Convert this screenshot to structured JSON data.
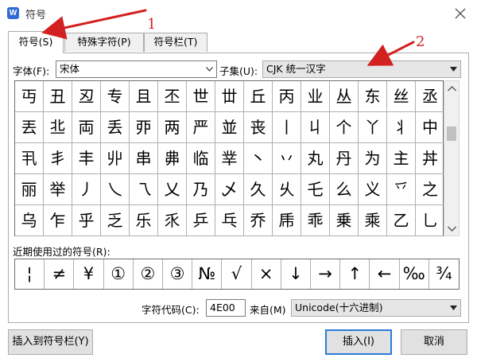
{
  "window": {
    "title": "符号",
    "app_icon": "W",
    "close_icon": "close-icon"
  },
  "tabs": [
    {
      "label": "符号(S)",
      "active": true
    },
    {
      "label": "特殊字符(P)",
      "active": false
    },
    {
      "label": "符号栏(T)",
      "active": false
    }
  ],
  "font": {
    "label": "字体(F):",
    "value": "宋体"
  },
  "subset": {
    "label": "子集(U):",
    "value": "CJK 统一汉字"
  },
  "symbol_grid": [
    [
      "丏",
      "丑",
      "丒",
      "专",
      "且",
      "丕",
      "世",
      "丗",
      "丘",
      "丙",
      "业",
      "丛",
      "东",
      "丝",
      "丞"
    ],
    [
      "丟",
      "丠",
      "両",
      "丢",
      "丣",
      "两",
      "严",
      "並",
      "丧",
      "丨",
      "丩",
      "个",
      "丫",
      "丬",
      "中"
    ],
    [
      "丮",
      "丯",
      "丰",
      "丱",
      "串",
      "丳",
      "临",
      "丵",
      "丶",
      "丷",
      "丸",
      "丹",
      "为",
      "主",
      "丼"
    ],
    [
      "丽",
      "举",
      "丿",
      "乀",
      "乁",
      "乂",
      "乃",
      "乄",
      "久",
      "乆",
      "乇",
      "么",
      "义",
      "乊",
      "之"
    ],
    [
      "乌",
      "乍",
      "乎",
      "乏",
      "乐",
      "乑",
      "乒",
      "乓",
      "乔",
      "乕",
      "乖",
      "乗",
      "乘",
      "乙",
      "乚"
    ]
  ],
  "recent": {
    "label": "近期使用过的符号(R):",
    "symbols": [
      "¦",
      "≠",
      "¥",
      "①",
      "②",
      "③",
      "№",
      "√",
      "×",
      "↓",
      "→",
      "↑",
      "←",
      "‰",
      "¾"
    ]
  },
  "char_code": {
    "label": "字符代码(C):",
    "value": "4E00"
  },
  "from": {
    "label": "来自(M)",
    "value": "Unicode(十六进制)"
  },
  "buttons": {
    "insert_to_bar": "插入到符号栏(Y)",
    "insert": "插入(I)",
    "cancel": "取消"
  },
  "annotations": {
    "num1": "1",
    "num2": "2",
    "color": "#d32020"
  },
  "colors": {
    "accent": "#2c7bd8",
    "icon_blue": "#2f6cd6"
  }
}
